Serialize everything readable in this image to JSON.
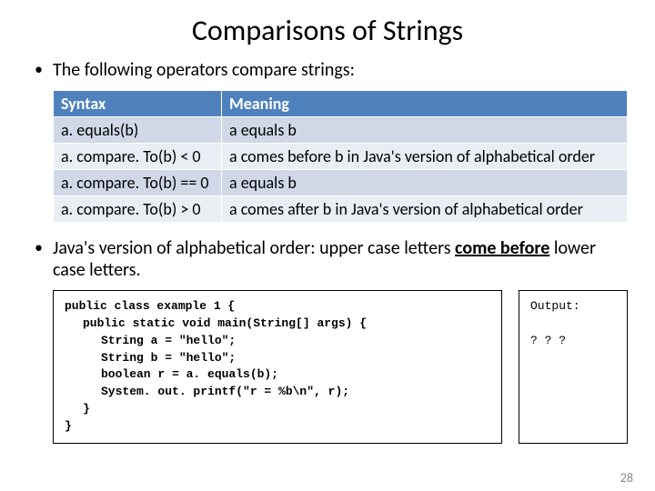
{
  "title": "Comparisons of Strings",
  "intro": "The following operators compare strings:",
  "table": {
    "header_syntax": "Syntax",
    "header_meaning": "Meaning",
    "r1_s": "a. equals(b)",
    "r1_m": "a equals b",
    "r2_s": "a. compare. To(b)  <  0",
    "r2_m": "a comes before b in Java's version of alphabetical order",
    "r3_s": "a. compare. To(b)  ==  0",
    "r3_m": "a equals b",
    "r4_s": "a. compare. To(b)  >  0",
    "r4_m": "a comes after b in Java's version of alphabetical order"
  },
  "note_before": "Java's version of alphabetical order: upper case letters ",
  "note_underlined": "come before",
  "note_after": " lower case letters.",
  "code": {
    "l1": "public class example 1 {",
    "l2": "public static void main(String[] args) {",
    "l3": "String a = \"hello\";",
    "l4": "String b = \"hello\";",
    "l5": "boolean r = a. equals(b);",
    "l6": "System. out. printf(\"r = %b\\n\", r);",
    "l7": "}",
    "l8": "}"
  },
  "output": {
    "label": "Output:",
    "value": "? ? ?"
  },
  "page_number": "28"
}
